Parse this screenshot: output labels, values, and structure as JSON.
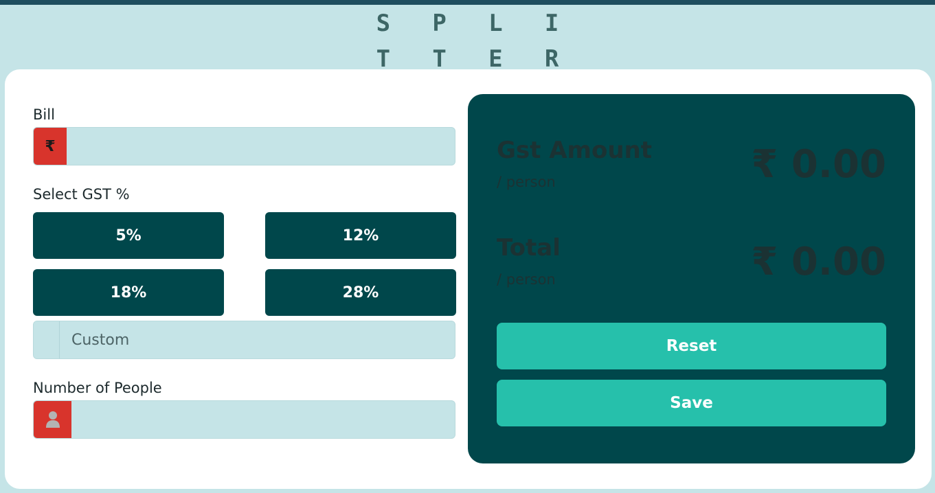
{
  "app": {
    "logo_line1": "S P L I",
    "logo_line2": "T T E R"
  },
  "form": {
    "bill_label": "Bill",
    "bill_prefix": "₹",
    "bill_value": "",
    "gst_label": "Select GST %",
    "gst_options": [
      "5%",
      "12%",
      "18%",
      "28%"
    ],
    "custom_placeholder": "Custom",
    "people_label": "Number of People",
    "people_value": ""
  },
  "results": {
    "gst_title": "Gst Amount",
    "gst_sub": "/ person",
    "gst_amount": "₹ 0.00",
    "total_title": "Total",
    "total_sub": "/ person",
    "total_amount": "₹ 0.00",
    "reset_label": "Reset",
    "save_label": "Save"
  },
  "colors": {
    "background": "#c5e4e7",
    "primary": "#00474b",
    "accent": "#26c0ab",
    "prefix_red": "#d8342c"
  },
  "icons": {
    "bill_prefix": "rupee-icon",
    "people_prefix": "person-icon"
  }
}
